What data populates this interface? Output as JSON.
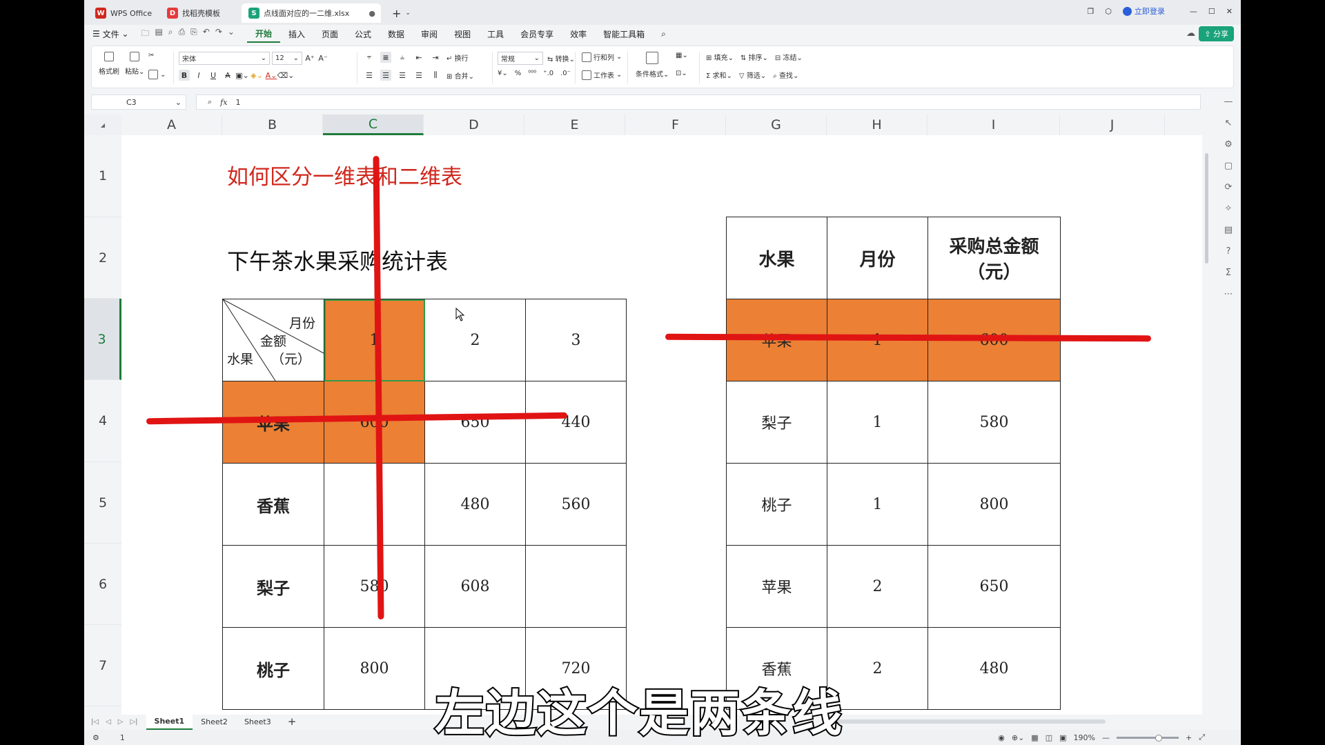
{
  "titlebar": {
    "tabs": [
      {
        "label": "WPS Office",
        "logo": "W",
        "color": "#d0281d"
      },
      {
        "label": "找稻壳模板",
        "logo": "D",
        "color": "#e53b3b"
      },
      {
        "label": "点线面对应的一二维.xlsx",
        "logo": "S",
        "color": "#1aa37a"
      }
    ],
    "login_label": "立即登录"
  },
  "menu": {
    "file_label": "文件",
    "items": [
      "开始",
      "插入",
      "页面",
      "公式",
      "数据",
      "审阅",
      "视图",
      "工具",
      "会员专享",
      "效率",
      "智能工具箱"
    ],
    "active_item": "开始",
    "share_label": "分享"
  },
  "ribbon": {
    "format_painter": "格式刷",
    "paste": "粘贴",
    "font_name": "宋体",
    "font_size": "12",
    "wrap": "换行",
    "merge": "合并",
    "number_format": "常规",
    "convert": "转换",
    "row_col": "行和列",
    "worksheet": "工作表",
    "cond_format": "条件格式",
    "fill": "填充",
    "sort": "排序",
    "freeze": "冻结",
    "sum": "求和",
    "filter": "筛选",
    "find": "查找"
  },
  "formula_bar": {
    "name_box": "C3",
    "fx": "fx",
    "value": "1"
  },
  "columns": [
    "A",
    "B",
    "C",
    "D",
    "E",
    "F",
    "G",
    "H",
    "I",
    "J"
  ],
  "selected_column": "C",
  "rows": [
    "1",
    "2",
    "3",
    "4",
    "5",
    "6",
    "7"
  ],
  "selected_row": "3",
  "sheet_titles": {
    "title1": "如何区分一维表和二维表",
    "title2": "下午茶水果采购统计表"
  },
  "left_table": {
    "corner_labels": {
      "col": "月份",
      "mid": "金额",
      "unit": "（元）",
      "row": "水果"
    },
    "months": [
      "1",
      "2",
      "3"
    ],
    "rows": [
      {
        "fruit": "苹果",
        "values": [
          "600",
          "650",
          "440"
        ]
      },
      {
        "fruit": "香蕉",
        "values": [
          "",
          "480",
          "560"
        ]
      },
      {
        "fruit": "梨子",
        "values": [
          "580",
          "608",
          ""
        ]
      },
      {
        "fruit": "桃子",
        "values": [
          "800",
          "",
          "720"
        ]
      }
    ]
  },
  "right_table": {
    "headers": [
      "水果",
      "月份",
      "采购总金额（元）"
    ],
    "rows": [
      {
        "fruit": "苹果",
        "month": "1",
        "amount": "600"
      },
      {
        "fruit": "梨子",
        "month": "1",
        "amount": "580"
      },
      {
        "fruit": "桃子",
        "month": "1",
        "amount": "800"
      },
      {
        "fruit": "苹果",
        "month": "2",
        "amount": "650"
      },
      {
        "fruit": "香蕉",
        "month": "2",
        "amount": "480"
      }
    ]
  },
  "sheet_tabs": [
    "Sheet1",
    "Sheet2",
    "Sheet3"
  ],
  "active_sheet": "Sheet1",
  "status": {
    "cell_value": "1",
    "zoom": "190%"
  },
  "subtitle": "左边这个是两条线",
  "colors": {
    "highlight": "#ec8034",
    "annotation": "#e11414",
    "accent": "#1e7b3a",
    "title_red": "#d0281d"
  }
}
